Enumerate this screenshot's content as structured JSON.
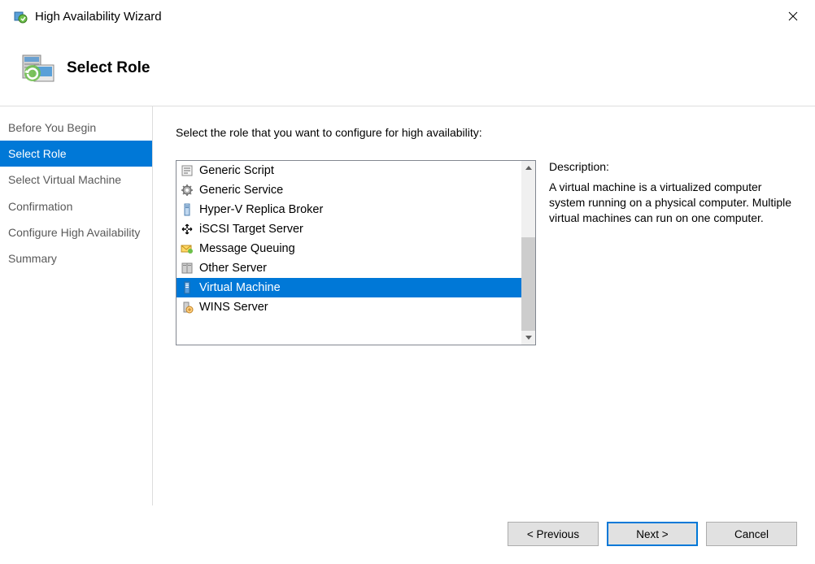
{
  "window": {
    "title": "High Availability Wizard"
  },
  "header": {
    "title": "Select Role"
  },
  "sidebar": {
    "items": [
      {
        "label": "Before You Begin",
        "selected": false
      },
      {
        "label": "Select Role",
        "selected": true
      },
      {
        "label": "Select Virtual Machine",
        "selected": false
      },
      {
        "label": "Confirmation",
        "selected": false
      },
      {
        "label": "Configure High Availability",
        "selected": false
      },
      {
        "label": "Summary",
        "selected": false
      }
    ]
  },
  "main": {
    "instruction": "Select the role that you want to configure for high availability:",
    "roles": [
      {
        "label": "Generic Script",
        "icon": "script-icon",
        "selected": false
      },
      {
        "label": "Generic Service",
        "icon": "gear-icon",
        "selected": false
      },
      {
        "label": "Hyper-V Replica Broker",
        "icon": "server-icon",
        "selected": false
      },
      {
        "label": "iSCSI Target Server",
        "icon": "iscsi-icon",
        "selected": false
      },
      {
        "label": "Message Queuing",
        "icon": "message-icon",
        "selected": false
      },
      {
        "label": "Other Server",
        "icon": "server-stack-icon",
        "selected": false
      },
      {
        "label": "Virtual Machine",
        "icon": "vm-icon",
        "selected": true
      },
      {
        "label": "WINS Server",
        "icon": "wins-icon",
        "selected": false
      }
    ],
    "description_label": "Description:",
    "description_text": "A virtual machine is a virtualized computer system running on a physical computer. Multiple virtual machines can run on one computer."
  },
  "footer": {
    "previous": "< Previous",
    "next": "Next >",
    "cancel": "Cancel"
  }
}
